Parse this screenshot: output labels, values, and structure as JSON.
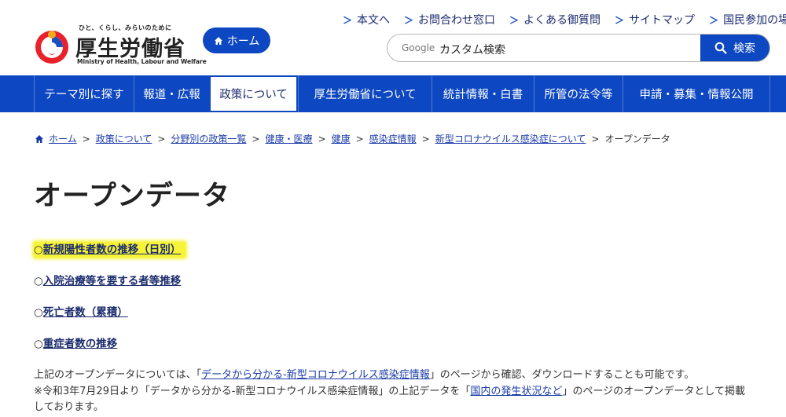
{
  "header": {
    "logo_tagline": "ひと、くらし、みらいのために",
    "logo_name": "厚生労働省",
    "logo_english": "Ministry of Health, Labour and Welfare",
    "home_button": "ホーム",
    "util_links": [
      "本文へ",
      "お問合わせ窓口",
      "よくある御質問",
      "サイトマップ",
      "国民参加の場"
    ],
    "search_brand": "Google",
    "search_placeholder": "カスタム検索",
    "search_button": "検索"
  },
  "nav": {
    "items": [
      {
        "label": "テーマ別に探す",
        "active": false
      },
      {
        "label": "報道・広報",
        "active": false
      },
      {
        "label": "政策について",
        "active": true
      },
      {
        "label": "厚生労働省について",
        "active": false
      },
      {
        "label": "統計情報・白書",
        "active": false
      },
      {
        "label": "所管の法令等",
        "active": false
      },
      {
        "label": "申請・募集・情報公開",
        "active": false
      }
    ]
  },
  "breadcrumb": {
    "items": [
      "ホーム",
      "政策について",
      "分野別の政策一覧",
      "健康・医療",
      "健康",
      "感染症情報",
      "新型コロナウイルス感染症について"
    ],
    "current": "オープンデータ"
  },
  "page": {
    "title": "オープンデータ",
    "bullet": "○",
    "data_links": [
      {
        "label": "新規陽性者数の推移（日別）",
        "highlighted": true
      },
      {
        "label": "入院治療等を要する者等推移",
        "highlighted": false
      },
      {
        "label": "死亡者数（累積）",
        "highlighted": false
      },
      {
        "label": "重症者数の推移",
        "highlighted": false
      }
    ],
    "desc1_pre": "上記のオープンデータについては、「",
    "desc1_link": "データから分かる-新型コロナウイルス感染症情報",
    "desc1_post": "」のページから確認、ダウンロードすることも可能です。",
    "desc2_pre": "※令和3年7月29日より「データから分かる-新型コロナウイルス感染症情報」の上記データを「",
    "desc2_link": "国内の発生状況など",
    "desc2_post": "」のページのオープンデータとして掲載",
    "desc3": "しております。"
  },
  "colors": {
    "primary_blue": "#0d47c1",
    "highlight_yellow": "#f7f337",
    "link": "#1a3aa8"
  }
}
